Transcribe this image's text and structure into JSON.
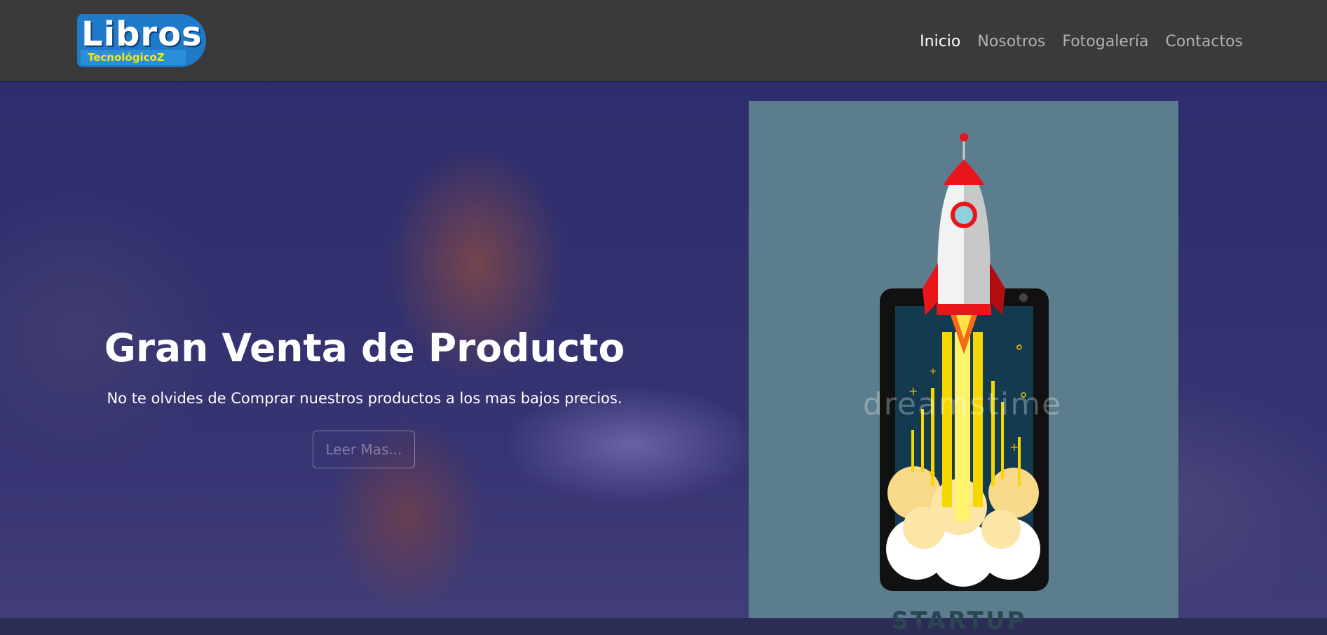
{
  "brand": {
    "logo_main": "Libros",
    "logo_sub": "TecnológicoZ"
  },
  "nav": {
    "items": [
      {
        "label": "Inicio",
        "active": true
      },
      {
        "label": "Nosotros",
        "active": false
      },
      {
        "label": "Fotogalería",
        "active": false
      },
      {
        "label": "Contactos",
        "active": false
      }
    ]
  },
  "hero": {
    "title": "Gran Venta de Producto",
    "subtitle": "No te olvides de Comprar nuestros productos a los mas bajos precios.",
    "button_label": "Leer Mas..."
  },
  "panel": {
    "watermark": "dreamstime",
    "caption": "STARTUP"
  },
  "colors": {
    "navbar_bg": "#3a3a3a",
    "nav_active": "#ffffff",
    "nav_inactive": "#b0b0b0",
    "panel_bg": "#5c7d8d",
    "logo_blue": "#1f7ac8",
    "logo_yellow": "#f3e61d"
  },
  "icons": [
    "rocket-icon",
    "smartphone-icon"
  ]
}
